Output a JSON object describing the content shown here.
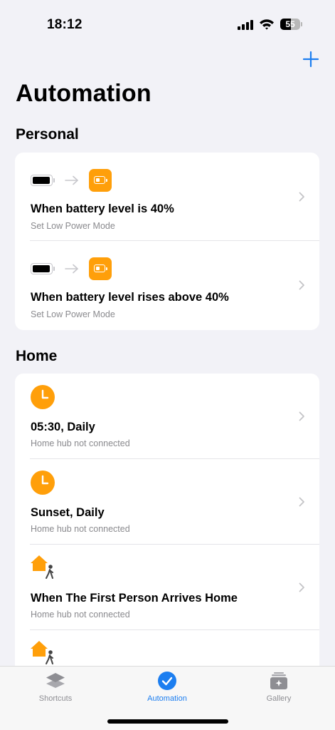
{
  "status_bar": {
    "time": "18:12",
    "battery_percent": "55"
  },
  "header": {
    "add_label": "+",
    "title": "Automation"
  },
  "sections": [
    {
      "title": "Personal",
      "items": [
        {
          "title": "When battery level is 40%",
          "subtitle": "Set Low Power Mode",
          "icon": "battery-to-low-power"
        },
        {
          "title": "When battery level rises above 40%",
          "subtitle": "Set Low Power Mode",
          "icon": "battery-to-low-power"
        }
      ]
    },
    {
      "title": "Home",
      "items": [
        {
          "title": "05:30, Daily",
          "subtitle": "Home hub not connected",
          "icon": "clock-icon"
        },
        {
          "title": "Sunset, Daily",
          "subtitle": "Home hub not connected",
          "icon": "clock-icon"
        },
        {
          "title": "When The First Person Arrives Home",
          "subtitle": "Home hub not connected",
          "icon": "home-arrive-icon"
        },
        {
          "title": "",
          "subtitle": "",
          "icon": "home-arrive-icon"
        }
      ]
    }
  ],
  "tab_bar": {
    "tabs": [
      {
        "label": "Shortcuts",
        "icon": "layers-icon",
        "active": false
      },
      {
        "label": "Automation",
        "icon": "automation-clock-icon",
        "active": true
      },
      {
        "label": "Gallery",
        "icon": "gallery-icon",
        "active": false
      }
    ]
  },
  "colors": {
    "accent": "#1c7ef0",
    "orange": "#ff9f0a",
    "background": "#f2f2f7"
  }
}
